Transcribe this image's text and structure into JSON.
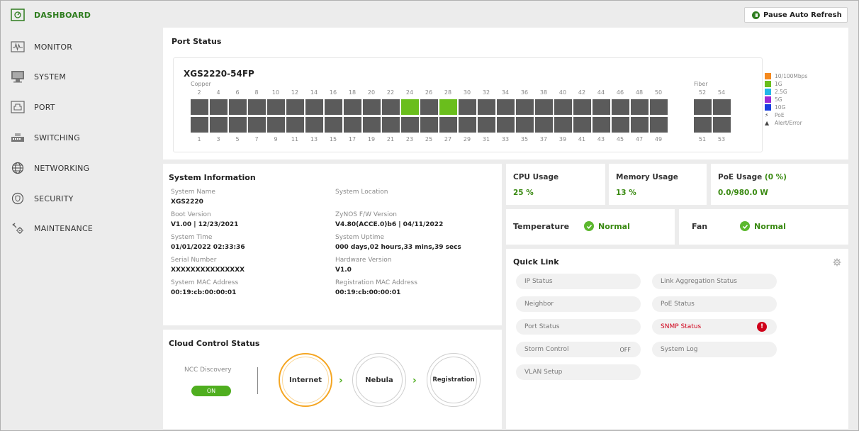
{
  "sidebar": {
    "items": [
      {
        "label": "DASHBOARD",
        "icon": "dashboard-icon"
      },
      {
        "label": "MONITOR",
        "icon": "monitor-icon"
      },
      {
        "label": "SYSTEM",
        "icon": "system-icon"
      },
      {
        "label": "PORT",
        "icon": "port-icon"
      },
      {
        "label": "SWITCHING",
        "icon": "switching-icon"
      },
      {
        "label": "NETWORKING",
        "icon": "networking-icon"
      },
      {
        "label": "SECURITY",
        "icon": "security-icon"
      },
      {
        "label": "MAINTENANCE",
        "icon": "maintenance-icon"
      }
    ]
  },
  "topbar": {
    "pause_label": "Pause Auto Refresh"
  },
  "port_status": {
    "title": "Port Status",
    "model": "XGS2220-54FP",
    "copper_label": "Copper",
    "fiber_label": "Fiber",
    "top_numbers": [
      "2",
      "4",
      "6",
      "8",
      "10",
      "12",
      "14",
      "16",
      "18",
      "20",
      "22",
      "24",
      "26",
      "28",
      "30",
      "32",
      "34",
      "36",
      "38",
      "40",
      "42",
      "44",
      "46",
      "48",
      "50"
    ],
    "bottom_numbers": [
      "1",
      "3",
      "5",
      "7",
      "9",
      "11",
      "13",
      "15",
      "17",
      "19",
      "21",
      "23",
      "25",
      "27",
      "29",
      "31",
      "33",
      "35",
      "37",
      "39",
      "41",
      "43",
      "45",
      "47",
      "49"
    ],
    "fiber_top": [
      "52",
      "54"
    ],
    "fiber_bottom": [
      "51",
      "53"
    ],
    "active_ports_1g": [
      "24",
      "28"
    ],
    "legend": [
      {
        "label": "10/100Mbps",
        "color": "#f5891e"
      },
      {
        "label": "1G",
        "color": "#6abe1c"
      },
      {
        "label": "2.5G",
        "color": "#22b7e8"
      },
      {
        "label": "5G",
        "color": "#9b2bd6"
      },
      {
        "label": "10G",
        "color": "#1a3fe0"
      },
      {
        "label": "PoE",
        "symbol": "⚡"
      },
      {
        "label": "Alert/Error",
        "symbol": "▲"
      }
    ]
  },
  "system_info": {
    "title": "System Information",
    "fields": [
      {
        "label": "System Name",
        "value": "XGS2220"
      },
      {
        "label": "System Location",
        "value": ""
      },
      {
        "label": "Boot Version",
        "value": "V1.00 | 12/23/2021"
      },
      {
        "label": "ZyNOS F/W Version",
        "value": "V4.80(ACCE.0)b6 | 04/11/2022"
      },
      {
        "label": "System Time",
        "value": "01/01/2022 02:33:36"
      },
      {
        "label": "System Uptime",
        "value": "000 days,02 hours,33 mins,39 secs"
      },
      {
        "label": "Serial Number",
        "value": "XXXXXXXXXXXXXXX"
      },
      {
        "label": "Hardware Version",
        "value": "V1.0"
      },
      {
        "label": "System MAC Address",
        "value": "00:19:cb:00:00:01"
      },
      {
        "label": "Registration MAC Address",
        "value": "00:19:cb:00:00:01"
      }
    ]
  },
  "usage": {
    "cpu_title": "CPU Usage",
    "cpu_value": "25 %",
    "mem_title": "Memory Usage",
    "mem_value": "13 %",
    "poe_title": "PoE Usage",
    "poe_pct": "(0 %)",
    "poe_value": "0.0/980.0 W"
  },
  "health": {
    "temp_title": "Temperature",
    "temp_status": "Normal",
    "fan_title": "Fan",
    "fan_status": "Normal"
  },
  "quick_link": {
    "title": "Quick Link",
    "items": [
      {
        "label": "IP Status"
      },
      {
        "label": "Link Aggregation Status"
      },
      {
        "label": "Neighbor"
      },
      {
        "label": "PoE Status"
      },
      {
        "label": "Port Status"
      },
      {
        "label": "SNMP Status",
        "alert": "!"
      },
      {
        "label": "Storm Control",
        "badge": "OFF"
      },
      {
        "label": "System Log"
      },
      {
        "label": "VLAN Setup"
      }
    ]
  },
  "cloud": {
    "title": "Cloud Control Status",
    "ncc_label": "NCC Discovery",
    "ncc_toggle": "ON",
    "steps": [
      "Internet",
      "Nebula",
      "Registration"
    ],
    "arrow": "›"
  }
}
